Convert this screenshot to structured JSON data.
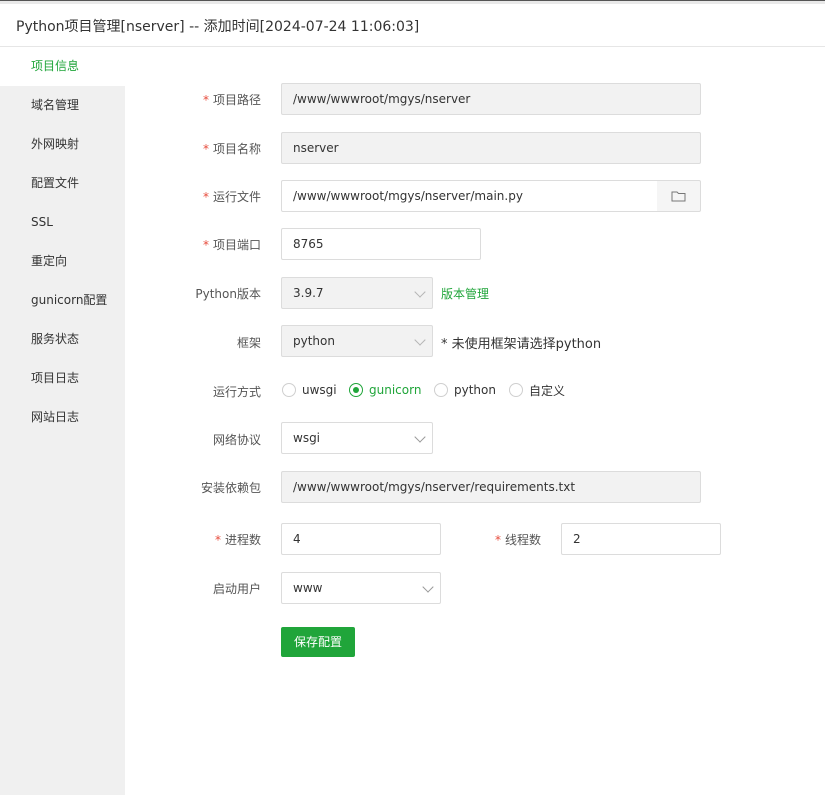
{
  "window": {
    "title": "Python项目管理[nserver] -- 添加时间[2024-07-24 11:06:03]"
  },
  "sidebar": {
    "items": [
      {
        "label": "项目信息",
        "active": true
      },
      {
        "label": "域名管理"
      },
      {
        "label": "外网映射"
      },
      {
        "label": "配置文件"
      },
      {
        "label": "SSL"
      },
      {
        "label": "重定向"
      },
      {
        "label": "gunicorn配置"
      },
      {
        "label": "服务状态"
      },
      {
        "label": "项目日志"
      },
      {
        "label": "网站日志"
      }
    ]
  },
  "form": {
    "required_mark": "*",
    "project_path": {
      "label": "项目路径",
      "value": "/www/wwwroot/mgys/nserver"
    },
    "project_name": {
      "label": "项目名称",
      "value": "nserver"
    },
    "run_file": {
      "label": "运行文件",
      "value": "/www/wwwroot/mgys/nserver/main.py",
      "browse_icon": "folder-icon"
    },
    "project_port": {
      "label": "项目端口",
      "value": "8765"
    },
    "python_version": {
      "label": "Python版本",
      "value": "3.9.7",
      "manage_link": "版本管理"
    },
    "framework": {
      "label": "框架",
      "value": "python",
      "hint": "* 未使用框架请选择python"
    },
    "run_mode": {
      "label": "运行方式",
      "options": [
        {
          "label": "uwsgi",
          "checked": false
        },
        {
          "label": "gunicorn",
          "checked": true
        },
        {
          "label": "python",
          "checked": false
        },
        {
          "label": "自定义",
          "checked": false
        }
      ]
    },
    "network_protocol": {
      "label": "网络协议",
      "value": "wsgi"
    },
    "install_deps": {
      "label": "安装依赖包",
      "value": "/www/wwwroot/mgys/nserver/requirements.txt"
    },
    "processes": {
      "label": "进程数",
      "value": "4"
    },
    "threads": {
      "label": "线程数",
      "value": "2"
    },
    "run_user": {
      "label": "启动用户",
      "value": "www"
    },
    "save_label": "保存配置"
  },
  "colors": {
    "accent": "#20a53a",
    "required": "#e74c3c",
    "sidebar_bg": "#f0f0f0"
  }
}
